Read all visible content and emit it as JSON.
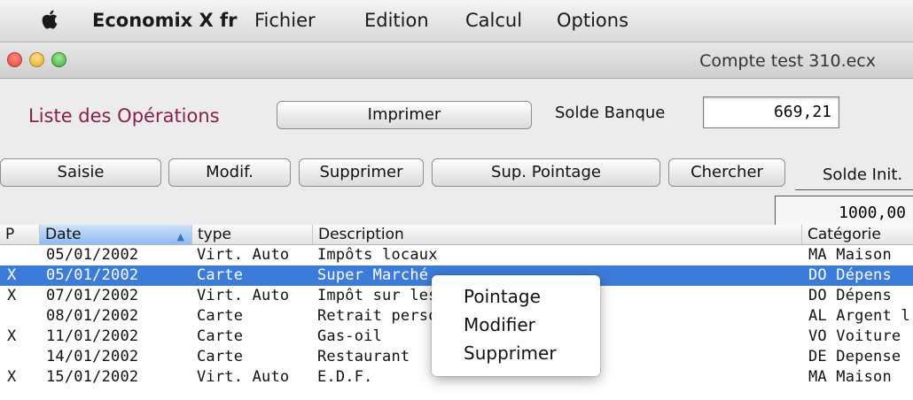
{
  "menubar": {
    "app_name": "Economix X fr",
    "items": [
      "Fichier",
      "Edition",
      "Calcul",
      "Options"
    ]
  },
  "window": {
    "title": "Compte test 310.ecx"
  },
  "toolbar": {
    "list_title": "Liste des Opérations",
    "print_label": "Imprimer",
    "solde_banque_label": "Solde Banque",
    "solde_banque_value": "669,21",
    "buttons": [
      "Saisie",
      "Modif.",
      "Supprimer",
      "Sup. Pointage",
      "Chercher"
    ],
    "solde_init_label": "Solde Init.",
    "solde_init_value": "1000,00"
  },
  "table": {
    "columns": [
      "P",
      "Date",
      "type",
      "Description",
      "Catégorie"
    ],
    "rows": [
      {
        "p": "",
        "date": "05/01/2002",
        "type": "Virt. Auto",
        "desc": "Impôts locaux",
        "cat": "MA Maison"
      },
      {
        "p": "X",
        "date": "05/01/2002",
        "type": "Carte",
        "desc": "Super Marché",
        "cat": "DO Dépens"
      },
      {
        "p": "X",
        "date": "07/01/2002",
        "type": "Virt. Auto",
        "desc": "Impôt sur les",
        "cat": "DO Dépens"
      },
      {
        "p": "",
        "date": "08/01/2002",
        "type": "Carte",
        "desc": "Retrait perso",
        "cat": "AL Argent l"
      },
      {
        "p": "X",
        "date": "11/01/2002",
        "type": "Carte",
        "desc": "Gas-oil",
        "cat": "VO Voiture"
      },
      {
        "p": "",
        "date": "14/01/2002",
        "type": "Carte",
        "desc": "Restaurant",
        "cat": "DE Depense"
      },
      {
        "p": "X",
        "date": "15/01/2002",
        "type": "Virt. Auto",
        "desc": "E.D.F.",
        "cat": "MA Maison"
      }
    ],
    "selected_row": 1
  },
  "context_menu": {
    "items": [
      "Pointage",
      "Modifier",
      "Supprimer"
    ]
  },
  "colors": {
    "title_accent": "#8a1f4b",
    "selection": "#3d7bd8"
  }
}
